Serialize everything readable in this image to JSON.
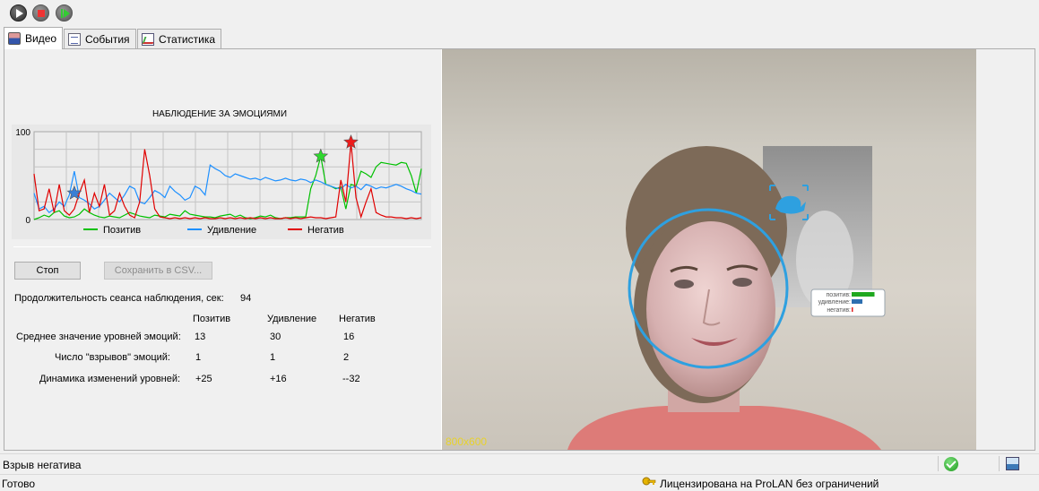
{
  "toolbar": {
    "play_icon": "play-icon",
    "stop_icon": "stop-icon",
    "step_icon": "step-forward-icon"
  },
  "tabs": [
    {
      "label": "Видео",
      "icon": "video-icon",
      "active": true
    },
    {
      "label": "События",
      "icon": "events-icon",
      "active": false
    },
    {
      "label": "Статистика",
      "icon": "statistics-icon",
      "active": false
    }
  ],
  "chart_data": {
    "type": "line",
    "title": "НАБЛЮДЕНИЕ ЗА ЭМОЦИЯМИ",
    "ylim": [
      0,
      100
    ],
    "y_ticks": [
      "100",
      "0"
    ],
    "grid": true,
    "legend_position": "bottom",
    "series": [
      {
        "name": "Позитив",
        "color": "#00c000",
        "values": [
          0,
          2,
          5,
          3,
          8,
          10,
          4,
          2,
          3,
          6,
          12,
          8,
          5,
          3,
          2,
          4,
          3,
          2,
          5,
          8,
          6,
          4,
          3,
          2,
          5,
          4,
          3,
          6,
          5,
          4,
          10,
          6,
          5,
          4,
          3,
          3,
          2,
          4,
          5,
          6,
          3,
          5,
          2,
          1,
          2,
          4,
          3,
          5,
          2,
          1,
          2,
          2,
          3,
          3,
          3,
          35,
          50,
          72,
          40,
          38,
          35,
          37,
          12,
          40,
          38,
          55,
          52,
          48,
          60,
          65,
          64,
          63,
          62,
          65,
          64,
          50,
          30,
          58
        ]
      },
      {
        "name": "Удивление",
        "color": "#1e90ff",
        "values": [
          30,
          12,
          15,
          8,
          12,
          20,
          15,
          28,
          55,
          25,
          22,
          18,
          12,
          15,
          22,
          30,
          25,
          20,
          28,
          38,
          35,
          20,
          18,
          25,
          33,
          30,
          25,
          38,
          32,
          28,
          22,
          25,
          38,
          35,
          28,
          62,
          58,
          55,
          50,
          48,
          52,
          50,
          48,
          46,
          47,
          45,
          48,
          46,
          44,
          45,
          47,
          45,
          44,
          46,
          45,
          42,
          45,
          43,
          40,
          38,
          36,
          35,
          40,
          36,
          38,
          34,
          40,
          38,
          35,
          37,
          36,
          38,
          40,
          38,
          35,
          33,
          30,
          29
        ]
      },
      {
        "name": "Негатив",
        "color": "#e00000",
        "values": [
          52,
          10,
          12,
          35,
          8,
          40,
          10,
          5,
          12,
          30,
          45,
          8,
          30,
          15,
          40,
          5,
          10,
          30,
          15,
          5,
          2,
          20,
          80,
          50,
          12,
          3,
          2,
          1,
          2,
          1,
          2,
          1,
          2,
          1,
          2,
          1,
          1,
          2,
          1,
          2,
          1,
          2,
          1,
          2,
          1,
          2,
          1,
          2,
          1,
          1,
          2,
          1,
          2,
          1,
          2,
          3,
          2,
          2,
          1,
          2,
          3,
          45,
          20,
          88,
          25,
          3,
          20,
          35,
          8,
          5,
          3,
          3,
          2,
          2,
          1,
          2,
          1,
          2
        ]
      }
    ],
    "markers": [
      {
        "series": "Позитив",
        "index": 57,
        "value": 72,
        "color": "#2ed82e"
      },
      {
        "series": "Негатив",
        "index": 63,
        "value": 88,
        "color": "#ee1a1a"
      },
      {
        "series": "Удивление",
        "index": 8,
        "value": 30,
        "color": "#3a7fd5"
      }
    ]
  },
  "controls": {
    "stop_label": "Стоп",
    "save_csv_label": "Сохранить в CSV..."
  },
  "session": {
    "duration_label": "Продолжительность сеанса наблюдения, сек:",
    "duration_value": "94"
  },
  "stats": {
    "columns": [
      "Позитив",
      "Удивление",
      "Негатив"
    ],
    "rows": [
      {
        "label": "Среднее значение уровней эмоций:",
        "values": [
          "13",
          "30",
          "16"
        ]
      },
      {
        "label": "Число \"взрывов\" эмоций:",
        "values": [
          "1",
          "1",
          "2"
        ]
      },
      {
        "label": "Динамика изменений уровней:",
        "values": [
          "+25",
          "+16",
          "--32"
        ]
      }
    ]
  },
  "video": {
    "resolution": "800x600",
    "overlay": {
      "rows": [
        {
          "label": "позитив:",
          "color": "#1fa81f",
          "level": 0.85
        },
        {
          "label": "удивление:",
          "color": "#2d6fb0",
          "level": 0.4
        },
        {
          "label": "негатив:",
          "color": "#e02020",
          "level": 0.05
        }
      ],
      "whale_icon": "whale-icon"
    }
  },
  "status": {
    "event_text": "Взрыв негатива",
    "ready_text": "Готово",
    "license_text": "Лицензирована на ProLAN без ограничений",
    "ok_icon": "check-ok-icon",
    "user_icon": "user-photo-icon",
    "key_icon": "key-icon"
  }
}
